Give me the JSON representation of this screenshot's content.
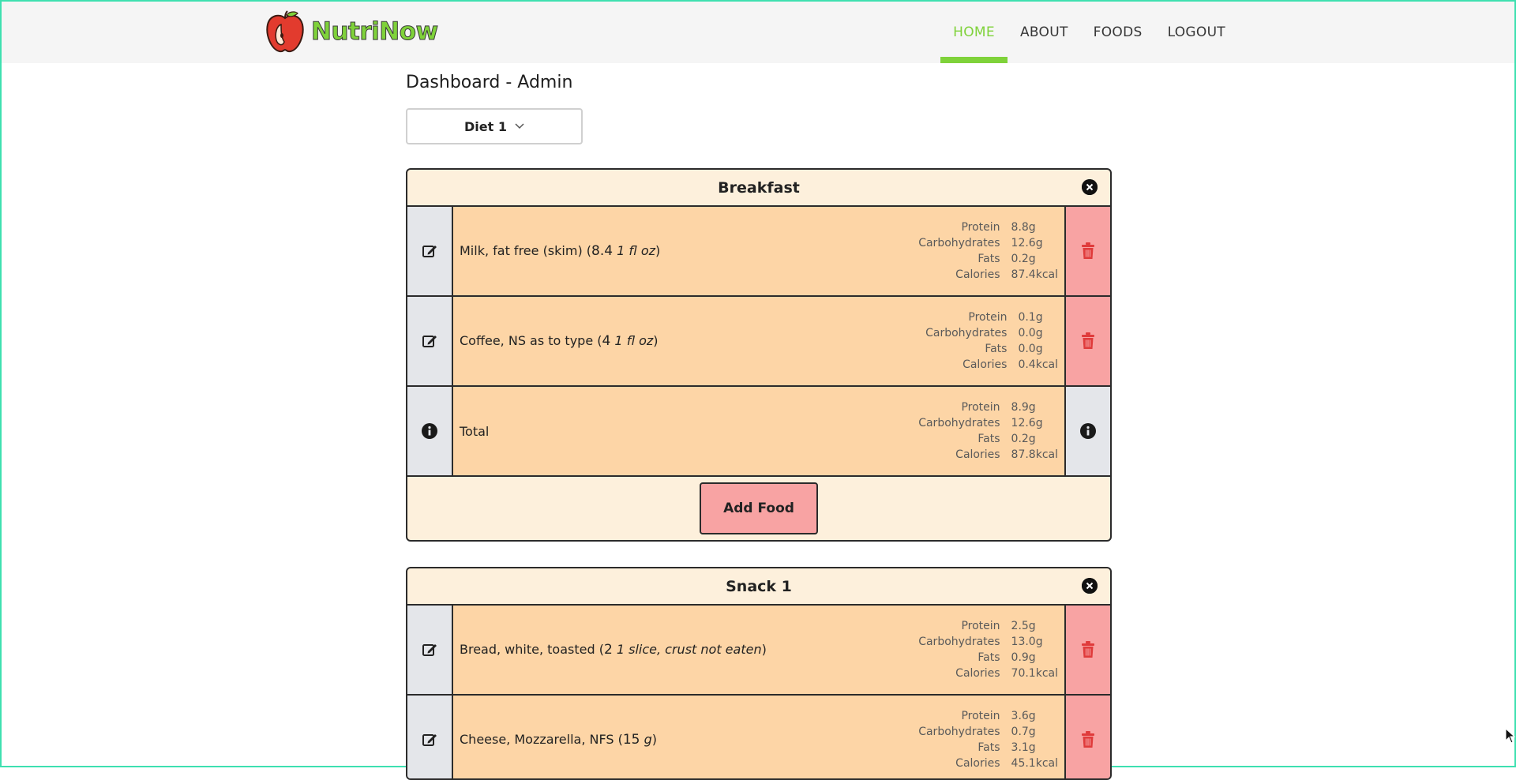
{
  "brand": {
    "name": "NutriNow"
  },
  "nav": {
    "items": [
      {
        "label": "HOME",
        "active": true
      },
      {
        "label": "ABOUT",
        "active": false
      },
      {
        "label": "FOODS",
        "active": false
      },
      {
        "label": "LOGOUT",
        "active": false
      }
    ]
  },
  "page": {
    "title": "Dashboard - Admin"
  },
  "diet_select": {
    "value": "Diet 1"
  },
  "labels": {
    "protein": "Protein",
    "carbs": "Carbohydrates",
    "fats": "Fats",
    "calories": "Calories",
    "add_food": "Add Food",
    "total": "Total"
  },
  "meals": [
    {
      "title": "Breakfast",
      "foods": [
        {
          "name": "Milk, fat free (skim) (",
          "amount": "8.4",
          "unit": "1 fl oz",
          "close": ")",
          "protein": "8.8g",
          "carbs": "12.6g",
          "fats": "0.2g",
          "calories": "87.4kcal"
        },
        {
          "name": "Coffee, NS as to type (",
          "amount": "4",
          "unit": "1 fl oz",
          "close": ")",
          "protein": "0.1g",
          "carbs": "0.0g",
          "fats": "0.0g",
          "calories": "0.4kcal"
        }
      ],
      "total": {
        "protein": "8.9g",
        "carbs": "12.6g",
        "fats": "0.2g",
        "calories": "87.8kcal"
      }
    },
    {
      "title": "Snack 1",
      "foods": [
        {
          "name": "Bread, white, toasted (",
          "amount": "2",
          "unit": "1 slice, crust not eaten",
          "close": ")",
          "protein": "2.5g",
          "carbs": "13.0g",
          "fats": "0.9g",
          "calories": "70.1kcal"
        },
        {
          "name": "Cheese, Mozzarella, NFS (",
          "amount": "15",
          "unit": "g",
          "close": ")",
          "protein": "3.6g",
          "carbs": "0.7g",
          "fats": "3.1g",
          "calories": "45.1kcal"
        }
      ]
    }
  ],
  "colors": {
    "accent": "#7fd23a",
    "meal_bg": "#fdf0dc",
    "row_bg": "#fdd5a6",
    "delete_bg": "#f8a3a3",
    "edit_bg": "#e4e6ea",
    "trash": "#e03c3c"
  },
  "icons": {
    "edit": "edit-icon",
    "delete": "trash-icon",
    "info": "info-icon",
    "close": "close-circle-icon",
    "chevron": "chevron-down-icon"
  }
}
